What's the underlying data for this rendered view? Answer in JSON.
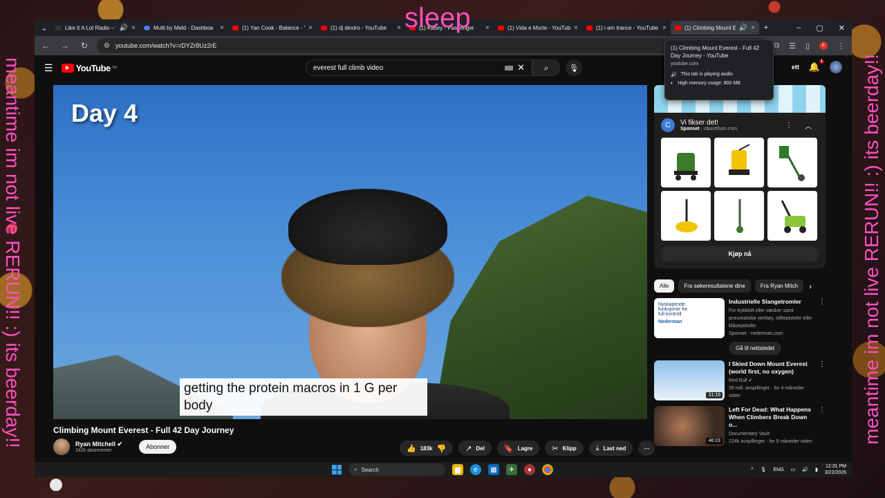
{
  "overlay": {
    "top": "sleep",
    "left": "meantime im not live RERUN!! :) its beerday!!",
    "right": "meantime im not live RERUN!! :) its beerday!!"
  },
  "tabs": [
    {
      "label": "Like It A Lot Radio – T",
      "icon": "radio-icon"
    },
    {
      "label": "Multi by Meld - Dashboa",
      "icon": "meld-icon"
    },
    {
      "label": "(1) Yan Cook - Balance - Y",
      "icon": "youtube-icon"
    },
    {
      "label": "(1) dj dextro - YouTube",
      "icon": "youtube-icon"
    },
    {
      "label": "(1) Kasey - Passenger",
      "icon": "youtube-icon"
    },
    {
      "label": "(1) Vida e Morte - YouTub",
      "icon": "youtube-icon"
    },
    {
      "label": "(1) i am trance - YouTube",
      "icon": "youtube-icon"
    },
    {
      "label": "(1) Climbing Mount E",
      "icon": "youtube-icon"
    }
  ],
  "address": {
    "url": "youtube.com/watch?v=rDYZr8Uz2rE"
  },
  "tooltip": {
    "title": "(1) Climbing Mount Everest - Full 42 Day Journey - YouTube",
    "host": "youtube.com",
    "audio": "This tab is playing audio",
    "memory": "High memory usage: 800 MB"
  },
  "youtube": {
    "logo": "YouTube",
    "region": "NO",
    "search_value": "everest full climb video",
    "header_partial": "ett",
    "notif_count": "1"
  },
  "video": {
    "day_label": "Day 4",
    "caption": "getting the protein macros in 1 G per body",
    "title": "Climbing Mount Everest - Full 42 Day Journey",
    "channel": "Ryan Mitchell",
    "subs": "342k abonnenter",
    "subscribe": "Abonner",
    "likes": "183k",
    "share": "Del",
    "save": "Lagre",
    "clip": "Klipp",
    "download": "Last ned"
  },
  "ad": {
    "title": "Vi fikser det!",
    "sponsor": "Sponset",
    "domain": "clasohlson.com",
    "cta": "Kjøp nå"
  },
  "chips": [
    "Alle",
    "Fra søkeresultatene dine",
    "Fra Ryan Mitch"
  ],
  "recs": [
    {
      "title": "Industrielle Slangetromler",
      "line1": "For trykkluft eller væsker samt pneumatiske verktøy, stiftepistoler eller blåsepistoler.",
      "line2": "Sponset · nederman.com",
      "cta": "Gå til nettstedet",
      "thumb_text": "Nyskapende funksjoner for full kontroll",
      "thumb_brand": "Nederman"
    },
    {
      "title": "I Skied Down Mount Everest (world first, no oxygen)",
      "line1": "Red Bull",
      "line2": "35 mill. avspillinger · for 4 måneder siden",
      "duration": "31:16"
    },
    {
      "title": "Left For Dead: What Happens When Climbers Break Down o...",
      "line1": "Documentary Vault",
      "line2": "224k avspillinger · for 5 måneder siden",
      "duration": "46:23"
    }
  ],
  "taskbar": {
    "search": "Search",
    "lang": "ENG",
    "time": "12:31 PM",
    "date": "3/22/2026"
  }
}
